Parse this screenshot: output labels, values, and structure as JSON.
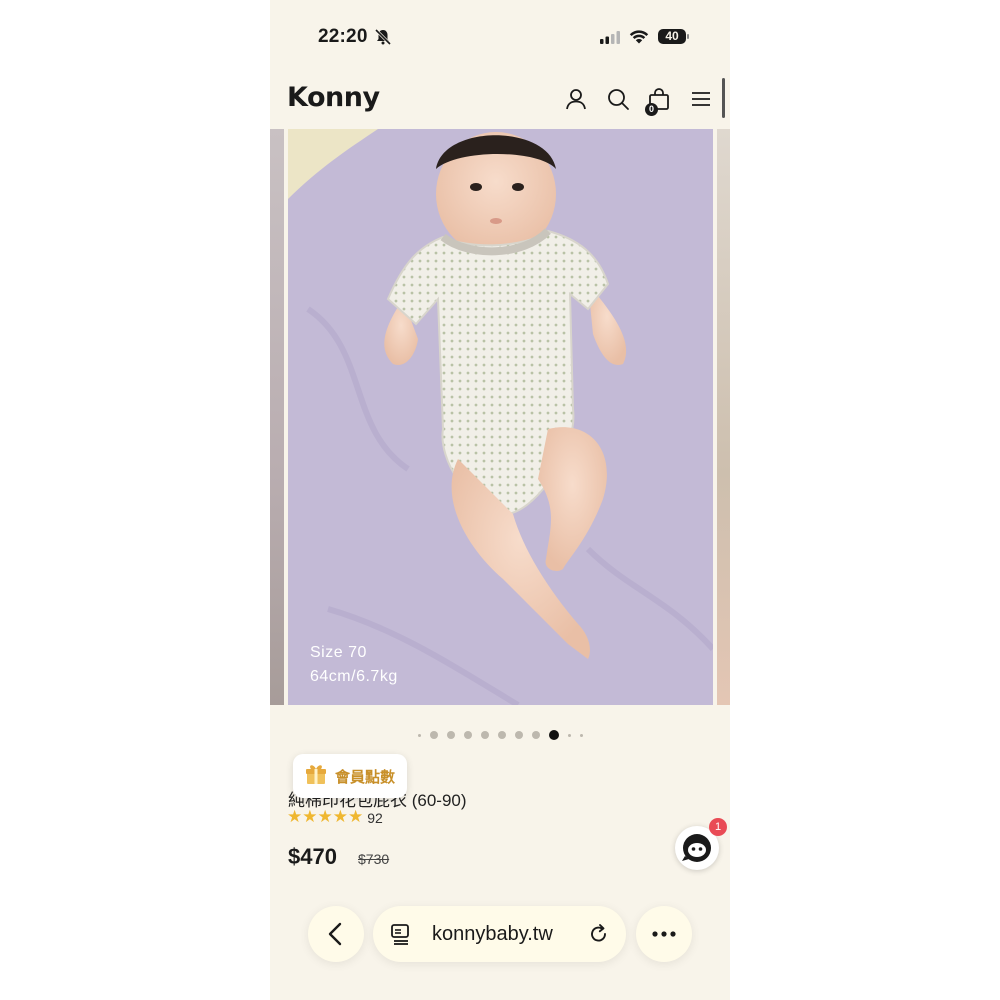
{
  "status_bar": {
    "time": "22:20",
    "battery": "40"
  },
  "header": {
    "logo": "Konny",
    "cart_count": "0"
  },
  "gallery": {
    "size_line1": "Size 70",
    "size_line2": "64cm/6.7kg",
    "dots_total": 11,
    "active_dot": 8
  },
  "reward": {
    "label": "會員點數"
  },
  "product": {
    "title": "純棉印花包屁衣 (60-90)",
    "rating_stars": 5,
    "review_count": "92",
    "price": "$470",
    "original_price": "$730"
  },
  "chat": {
    "badge": "1"
  },
  "browser": {
    "url": "konnybaby.tw"
  },
  "colors": {
    "background": "#f8f4ea",
    "reward_text": "#c8902a",
    "star": "#efb730",
    "badge": "#e94b55"
  }
}
